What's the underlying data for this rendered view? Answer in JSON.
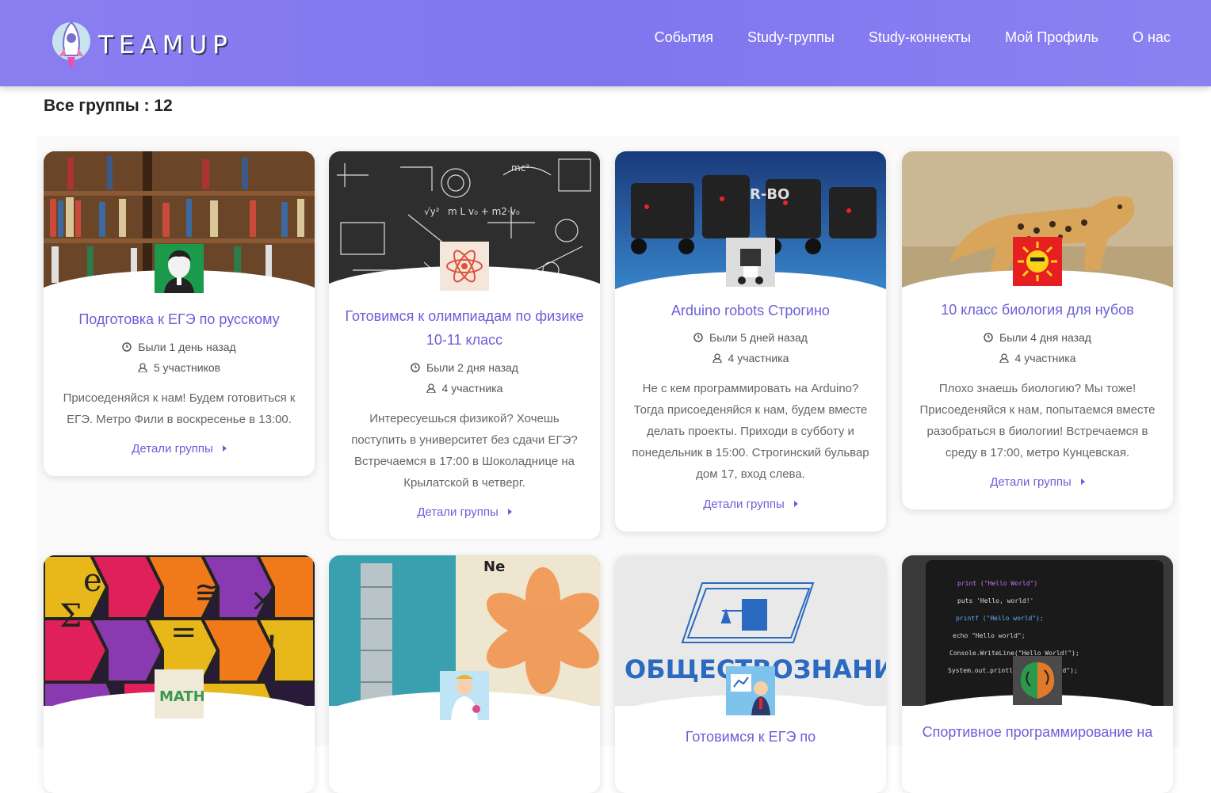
{
  "header": {
    "logo_text": "TEAMUP",
    "nav": [
      "События",
      "Study-группы",
      "Study-коннекты",
      "Мой Профиль",
      "О нас"
    ]
  },
  "page": {
    "title": "Все группы : 12"
  },
  "groups": [
    {
      "title": "Подготовка к ЕГЭ по русскому",
      "seen": "Были 1 день назад",
      "members": "5 участников",
      "description": "Присоеденяйся к нам! Будем готовиться к ЕГЭ. Метро Фили в воскресенье в 13:00.",
      "details": "Детали группы"
    },
    {
      "title": "Готовимся к олимпиадам по физике 10-11 класс",
      "seen": "Были 2 дня назад",
      "members": "4 участника",
      "description": "Интересуешься физикой? Хочешь поступить в университет без сдачи ЕГЭ? Встречаемся в 17:00 в Шоколаднице на Крылатской в четверг.",
      "details": "Детали группы"
    },
    {
      "title": "Arduino robots Строгино",
      "seen": "Были 5 дней назад",
      "members": "4 участника",
      "description": "Не с кем программировать на Arduino? Тогда присоеденяйся к нам, будем вместе делать проекты. Приходи в субботу и понедельник в 15:00. Строгинский бульвар дом 17, вход слева.",
      "details": "Детали группы"
    },
    {
      "title": "10 класс биология для нубов",
      "seen": "Были 4 дня назад",
      "members": "4 участника",
      "description": "Плохо знаешь биологию? Мы тоже! Присоеденяйся к нам, попытаемся вместе разобраться в биологии! Встречаемся в среду в 17:00, метро Кунцевская.",
      "details": "Детали группы"
    },
    {
      "title": "",
      "image_text": "ОБЩЕСТВОЗНАНИЕ"
    },
    {
      "title": "Готовимся к ЕГЭ по"
    },
    {
      "title": "Спортивное программирование на",
      "code_lines": [
        "print (\"Hello World\")",
        "puts 'Hello, world!'",
        "printf (\"Hello world\");",
        "echo \"Hello world\";",
        "Console.WriteLine(\"Hello World!\");",
        "System.out.println(\"Hello World\");"
      ]
    }
  ],
  "colors": {
    "accent": "#6a5fd8",
    "header": "#8a7ff0"
  }
}
